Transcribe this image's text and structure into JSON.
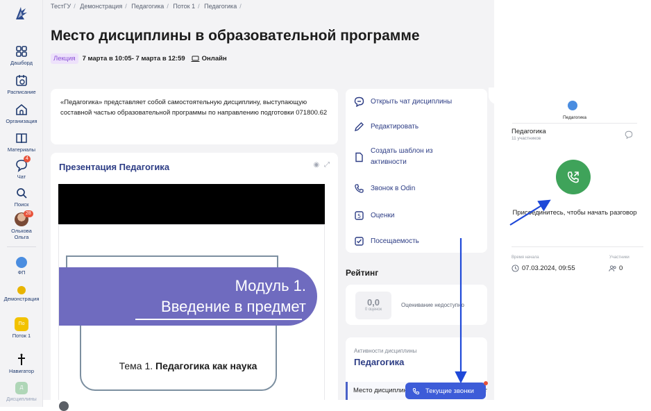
{
  "breadcrumb": [
    "ТестГУ",
    "Демонстрация",
    "Педагогика",
    "Поток 1",
    "Педагогика"
  ],
  "page": {
    "title": "Место дисциплины в образовательной программе",
    "tag": "Лекция",
    "date": "7 марта в 10:05- 7 марта в 12:59",
    "mode": "Онлайн",
    "description": "«Педагогика» представляет собой самостоятельную дисциплину, выступающую составной частью образовательной программы по направлению подготовки 071800.62"
  },
  "sidebar": {
    "items": [
      {
        "label": "Дашборд",
        "icon": "dashboard-icon"
      },
      {
        "label": "Расписание",
        "icon": "calendar-icon"
      },
      {
        "label": "Организация",
        "icon": "building-icon"
      },
      {
        "label": "Материалы",
        "icon": "book-icon"
      },
      {
        "label": "Чат",
        "icon": "chat-icon",
        "badge": "4"
      },
      {
        "label": "Поиск",
        "icon": "search-icon"
      },
      {
        "label": "Олькова Ольга",
        "icon": "avatar",
        "badge": "28"
      },
      {
        "label": "ФП",
        "icon": "org-icon"
      },
      {
        "label": "Демонстрация",
        "icon": "org-icon"
      },
      {
        "label": "Поток 1",
        "icon": "group-icon",
        "short": "По"
      },
      {
        "label": "Навигатор",
        "icon": "navigator-icon"
      },
      {
        "label": "Дисциплины",
        "icon": "discipline-icon",
        "short": "Д"
      }
    ]
  },
  "presentation": {
    "title": "Презентация Педагогика",
    "slide_module_line1": "Модуль 1.",
    "slide_module_line2": "Введение в предмет",
    "slide_theme_prefix": "Тема 1.",
    "slide_theme_bold": "Педагогика как наука"
  },
  "actions": [
    {
      "label": "Открыть чат дисциплины",
      "icon": "chat-bubble-icon"
    },
    {
      "label": "Редактировать",
      "icon": "pencil-icon"
    },
    {
      "label": "Создать шаблон из активности",
      "icon": "template-icon"
    },
    {
      "label": "Звонок в Odin",
      "icon": "phone-icon"
    },
    {
      "label": "Оценки",
      "icon": "grades-icon"
    },
    {
      "label": "Посещаемость",
      "icon": "attendance-icon"
    }
  ],
  "rating": {
    "title": "Рейтинг",
    "score": "0,0",
    "score_sub": "0 оценок",
    "note": "Оценивание недоступно"
  },
  "activities": {
    "label": "Активности дисциплины",
    "name": "Педагогика",
    "current_item": "Место дисциплины в образовательной программе"
  },
  "calls_button": "Текущие звонки",
  "call_panel": {
    "tab_label": "Педагогика",
    "chat_name": "Педагогика",
    "chat_members": "11 участников",
    "join_text": "Присоединитесь, чтобы начать разговор",
    "start_label": "Время начала",
    "start_value": "07.03.2024, 09:55",
    "participants_label": "Участники",
    "participants_value": "0"
  },
  "colors": {
    "accent": "#2c3c84",
    "call_green": "#3fa35a",
    "button_blue": "#3d5cd8",
    "tag_purple": "#8a4fd6",
    "slide_banner": "#6f6bbf"
  }
}
